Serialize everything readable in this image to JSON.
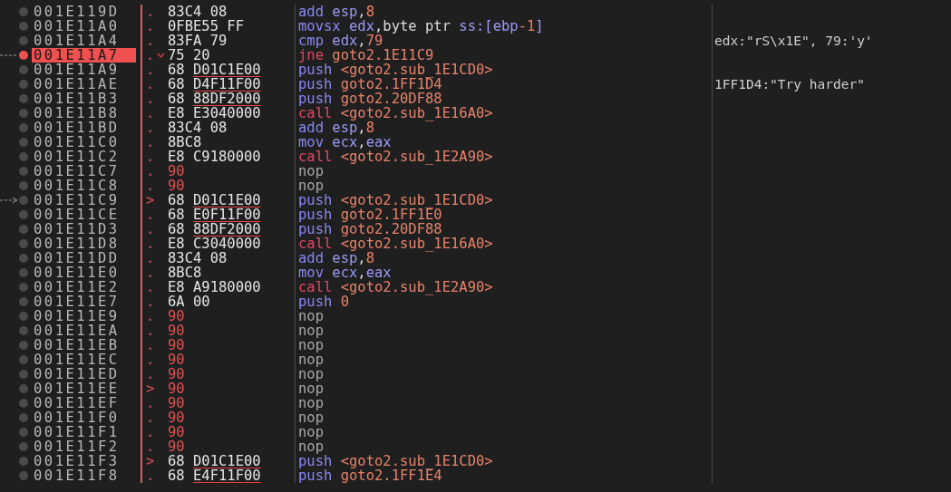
{
  "rows": [
    {
      "address": "001E119D",
      "breakpoint": false,
      "marker": ".",
      "branch_icon": false,
      "bytes": [
        "83C4",
        "08"
      ],
      "reloc": false,
      "asm": [
        {
          "text": "add ",
          "kind": "mnemonic"
        },
        {
          "text": "esp",
          "kind": "register"
        },
        {
          "text": ",",
          "kind": "plain"
        },
        {
          "text": "8",
          "kind": "value"
        }
      ]
    },
    {
      "address": "001E11A0",
      "breakpoint": false,
      "marker": ".",
      "branch_icon": false,
      "bytes": [
        "0FBE55",
        "FF"
      ],
      "reloc": false,
      "asm": [
        {
          "text": "movsx ",
          "kind": "mnemonic"
        },
        {
          "text": "edx",
          "kind": "register"
        },
        {
          "text": ",byte ptr ",
          "kind": "plain"
        },
        {
          "text": "ss:[ebp",
          "kind": "register"
        },
        {
          "text": "-1",
          "kind": "value"
        },
        {
          "text": "]",
          "kind": "register"
        }
      ]
    },
    {
      "address": "001E11A4",
      "breakpoint": false,
      "marker": ".",
      "branch_icon": false,
      "bytes": [
        "83FA",
        "79"
      ],
      "reloc": false,
      "asm": [
        {
          "text": "cmp ",
          "kind": "mnemonic"
        },
        {
          "text": "edx",
          "kind": "register"
        },
        {
          "text": ",",
          "kind": "plain"
        },
        {
          "text": "79",
          "kind": "value"
        }
      ],
      "comment": "edx:\"rS\\x1E\", 79:'y'"
    },
    {
      "address": "001E11A7",
      "breakpoint": true,
      "arrow": {
        "kind": "dashed-line"
      },
      "marker": ".",
      "branch_icon": true,
      "bytes": [
        "75",
        "20"
      ],
      "reloc": false,
      "asm": [
        {
          "text": "jne ",
          "kind": "branch"
        },
        {
          "text": "goto2.1E11C9",
          "kind": "value"
        }
      ]
    },
    {
      "address": "001E11A9",
      "breakpoint": false,
      "marker": ".",
      "branch_icon": false,
      "bytes": [
        "68",
        "D01C1E00"
      ],
      "reloc": true,
      "asm": [
        {
          "text": "push ",
          "kind": "mnemonic"
        },
        {
          "text": "<goto2.sub_1E1CD0>",
          "kind": "value"
        }
      ]
    },
    {
      "address": "001E11AE",
      "breakpoint": false,
      "marker": ".",
      "branch_icon": false,
      "bytes": [
        "68",
        "D4F11F00"
      ],
      "reloc": true,
      "asm": [
        {
          "text": "push ",
          "kind": "mnemonic"
        },
        {
          "text": "goto2.1FF1D4",
          "kind": "value"
        }
      ],
      "comment": "1FF1D4:\"Try harder\""
    },
    {
      "address": "001E11B3",
      "breakpoint": false,
      "marker": ".",
      "branch_icon": false,
      "bytes": [
        "68",
        "88DF2000"
      ],
      "reloc": true,
      "asm": [
        {
          "text": "push ",
          "kind": "mnemonic"
        },
        {
          "text": "goto2.20DF88",
          "kind": "value"
        }
      ]
    },
    {
      "address": "001E11B8",
      "breakpoint": false,
      "marker": ".",
      "branch_icon": false,
      "bytes": [
        "E8",
        "E3040000"
      ],
      "reloc": false,
      "asm": [
        {
          "text": "call ",
          "kind": "branch"
        },
        {
          "text": "<goto2.sub_1E16A0>",
          "kind": "value"
        }
      ]
    },
    {
      "address": "001E11BD",
      "breakpoint": false,
      "marker": ".",
      "branch_icon": false,
      "bytes": [
        "83C4",
        "08"
      ],
      "reloc": false,
      "asm": [
        {
          "text": "add ",
          "kind": "mnemonic"
        },
        {
          "text": "esp",
          "kind": "register"
        },
        {
          "text": ",",
          "kind": "plain"
        },
        {
          "text": "8",
          "kind": "value"
        }
      ]
    },
    {
      "address": "001E11C0",
      "breakpoint": false,
      "marker": ".",
      "branch_icon": false,
      "bytes": [
        "8BC8"
      ],
      "reloc": false,
      "asm": [
        {
          "text": "mov ",
          "kind": "mnemonic"
        },
        {
          "text": "ecx",
          "kind": "register"
        },
        {
          "text": ",",
          "kind": "plain"
        },
        {
          "text": "eax",
          "kind": "register"
        }
      ]
    },
    {
      "address": "001E11C2",
      "breakpoint": false,
      "marker": ".",
      "branch_icon": false,
      "bytes": [
        "E8",
        "C9180000"
      ],
      "reloc": false,
      "asm": [
        {
          "text": "call ",
          "kind": "branch"
        },
        {
          "text": "<goto2.sub_1E2A90>",
          "kind": "value"
        }
      ]
    },
    {
      "address": "001E11C7",
      "breakpoint": false,
      "marker": ".",
      "branch_icon": false,
      "bytes": [
        "90"
      ],
      "reloc": false,
      "asm": [
        {
          "text": "nop",
          "kind": "nop"
        }
      ]
    },
    {
      "address": "001E11C8",
      "breakpoint": false,
      "marker": ".",
      "branch_icon": false,
      "bytes": [
        "90"
      ],
      "reloc": false,
      "asm": [
        {
          "text": "nop",
          "kind": "nop"
        }
      ]
    },
    {
      "address": "001E11C9",
      "breakpoint": false,
      "arrow": {
        "kind": "dashed-arrow"
      },
      "marker": ">",
      "branch_icon": false,
      "bytes": [
        "68",
        "D01C1E00"
      ],
      "reloc": true,
      "asm": [
        {
          "text": "push ",
          "kind": "mnemonic"
        },
        {
          "text": "<goto2.sub_1E1CD0>",
          "kind": "value"
        }
      ]
    },
    {
      "address": "001E11CE",
      "breakpoint": false,
      "marker": ".",
      "branch_icon": false,
      "bytes": [
        "68",
        "E0F11F00"
      ],
      "reloc": true,
      "asm": [
        {
          "text": "push ",
          "kind": "mnemonic"
        },
        {
          "text": "goto2.1FF1E0",
          "kind": "value"
        }
      ]
    },
    {
      "address": "001E11D3",
      "breakpoint": false,
      "marker": ".",
      "branch_icon": false,
      "bytes": [
        "68",
        "88DF2000"
      ],
      "reloc": true,
      "asm": [
        {
          "text": "push ",
          "kind": "mnemonic"
        },
        {
          "text": "goto2.20DF88",
          "kind": "value"
        }
      ]
    },
    {
      "address": "001E11D8",
      "breakpoint": false,
      "marker": ".",
      "branch_icon": false,
      "bytes": [
        "E8",
        "C3040000"
      ],
      "reloc": false,
      "asm": [
        {
          "text": "call ",
          "kind": "branch"
        },
        {
          "text": "<goto2.sub_1E16A0>",
          "kind": "value"
        }
      ]
    },
    {
      "address": "001E11DD",
      "breakpoint": false,
      "marker": ".",
      "branch_icon": false,
      "bytes": [
        "83C4",
        "08"
      ],
      "reloc": false,
      "asm": [
        {
          "text": "add ",
          "kind": "mnemonic"
        },
        {
          "text": "esp",
          "kind": "register"
        },
        {
          "text": ",",
          "kind": "plain"
        },
        {
          "text": "8",
          "kind": "value"
        }
      ]
    },
    {
      "address": "001E11E0",
      "breakpoint": false,
      "marker": ".",
      "branch_icon": false,
      "bytes": [
        "8BC8"
      ],
      "reloc": false,
      "asm": [
        {
          "text": "mov ",
          "kind": "mnemonic"
        },
        {
          "text": "ecx",
          "kind": "register"
        },
        {
          "text": ",",
          "kind": "plain"
        },
        {
          "text": "eax",
          "kind": "register"
        }
      ]
    },
    {
      "address": "001E11E2",
      "breakpoint": false,
      "marker": ".",
      "branch_icon": false,
      "bytes": [
        "E8",
        "A9180000"
      ],
      "reloc": false,
      "asm": [
        {
          "text": "call ",
          "kind": "branch"
        },
        {
          "text": "<goto2.sub_1E2A90>",
          "kind": "value"
        }
      ]
    },
    {
      "address": "001E11E7",
      "breakpoint": false,
      "marker": ".",
      "branch_icon": false,
      "bytes": [
        "6A",
        "00"
      ],
      "reloc": false,
      "asm": [
        {
          "text": "push ",
          "kind": "mnemonic"
        },
        {
          "text": "0",
          "kind": "value"
        }
      ]
    },
    {
      "address": "001E11E9",
      "breakpoint": false,
      "marker": ".",
      "branch_icon": false,
      "bytes": [
        "90"
      ],
      "reloc": false,
      "asm": [
        {
          "text": "nop",
          "kind": "nop"
        }
      ]
    },
    {
      "address": "001E11EA",
      "breakpoint": false,
      "marker": ".",
      "branch_icon": false,
      "bytes": [
        "90"
      ],
      "reloc": false,
      "asm": [
        {
          "text": "nop",
          "kind": "nop"
        }
      ]
    },
    {
      "address": "001E11EB",
      "breakpoint": false,
      "marker": ".",
      "branch_icon": false,
      "bytes": [
        "90"
      ],
      "reloc": false,
      "asm": [
        {
          "text": "nop",
          "kind": "nop"
        }
      ]
    },
    {
      "address": "001E11EC",
      "breakpoint": false,
      "marker": ".",
      "branch_icon": false,
      "bytes": [
        "90"
      ],
      "reloc": false,
      "asm": [
        {
          "text": "nop",
          "kind": "nop"
        }
      ]
    },
    {
      "address": "001E11ED",
      "breakpoint": false,
      "marker": ".",
      "branch_icon": false,
      "bytes": [
        "90"
      ],
      "reloc": false,
      "asm": [
        {
          "text": "nop",
          "kind": "nop"
        }
      ]
    },
    {
      "address": "001E11EE",
      "breakpoint": false,
      "marker": ">",
      "branch_icon": false,
      "bytes": [
        "90"
      ],
      "reloc": false,
      "asm": [
        {
          "text": "nop",
          "kind": "nop"
        }
      ]
    },
    {
      "address": "001E11EF",
      "breakpoint": false,
      "marker": ".",
      "branch_icon": false,
      "bytes": [
        "90"
      ],
      "reloc": false,
      "asm": [
        {
          "text": "nop",
          "kind": "nop"
        }
      ]
    },
    {
      "address": "001E11F0",
      "breakpoint": false,
      "marker": ".",
      "branch_icon": false,
      "bytes": [
        "90"
      ],
      "reloc": false,
      "asm": [
        {
          "text": "nop",
          "kind": "nop"
        }
      ]
    },
    {
      "address": "001E11F1",
      "breakpoint": false,
      "marker": ".",
      "branch_icon": false,
      "bytes": [
        "90"
      ],
      "reloc": false,
      "asm": [
        {
          "text": "nop",
          "kind": "nop"
        }
      ]
    },
    {
      "address": "001E11F2",
      "breakpoint": false,
      "marker": ".",
      "branch_icon": false,
      "bytes": [
        "90"
      ],
      "reloc": false,
      "asm": [
        {
          "text": "nop",
          "kind": "nop"
        }
      ]
    },
    {
      "address": "001E11F3",
      "breakpoint": false,
      "marker": ">",
      "branch_icon": false,
      "bytes": [
        "68",
        "D01C1E00"
      ],
      "reloc": true,
      "asm": [
        {
          "text": "push ",
          "kind": "mnemonic"
        },
        {
          "text": "<goto2.sub_1E1CD0>",
          "kind": "value"
        }
      ]
    },
    {
      "address": "001E11F8",
      "breakpoint": false,
      "marker": ".",
      "branch_icon": false,
      "bytes": [
        "68",
        "E4F11F00"
      ],
      "reloc": true,
      "asm": [
        {
          "text": "push ",
          "kind": "mnemonic"
        },
        {
          "text": "goto2.1FF1E4",
          "kind": "value"
        }
      ]
    }
  ]
}
